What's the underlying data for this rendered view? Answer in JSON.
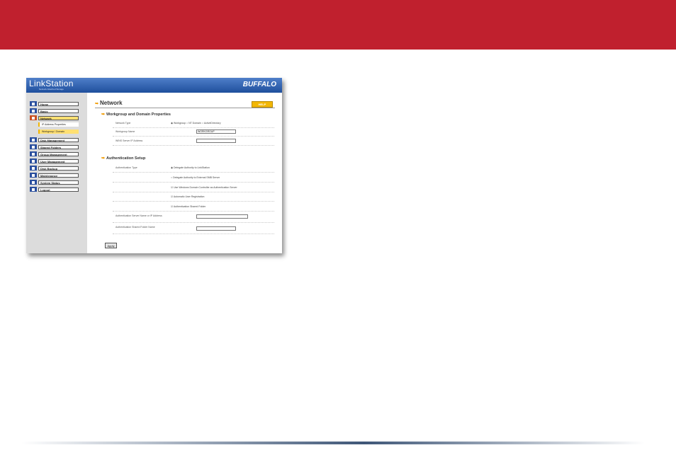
{
  "app": {
    "logo": "LinkStation",
    "logo_sub": "Network Attached Storage",
    "brand": "BUFFALO"
  },
  "sidebar": {
    "items": [
      {
        "label": "Home"
      },
      {
        "label": "Basic"
      },
      {
        "label": "Network"
      },
      {
        "label": "Disk Management"
      },
      {
        "label": "Shared Folders"
      },
      {
        "label": "Group Management"
      },
      {
        "label": "User Management"
      },
      {
        "label": "Disk Backup"
      },
      {
        "label": "Maintenance"
      },
      {
        "label": "System Status"
      },
      {
        "label": "Logout"
      }
    ],
    "subitems": [
      {
        "label": "IP Address Properties"
      },
      {
        "label": "Workgroup / Domain"
      }
    ]
  },
  "page": {
    "title": "Network",
    "help_label": "HELP",
    "section1": {
      "title": "Workgroup and Domain Properties",
      "network_type_label": "Network Type",
      "network_type_options": [
        "Workgroup",
        "NT Domain",
        "ActiveDirectory"
      ],
      "workgroup_name_label": "Workgroup Name",
      "workgroup_name_value": "WORKGROUP",
      "wins_label": "WINS Server IP Address",
      "wins_value": ""
    },
    "section2": {
      "title": "Authentication Setup",
      "auth_type_label": "Authentication Type",
      "auth_option1": "Delegate Authority to LinkStation",
      "auth_option2": "Delegate Authority to External SMB Server",
      "check1": "Use Windows Domain Controller as Authentication Server",
      "check2": "Automatic User Registration",
      "check3": "Authentication Shared Folder",
      "auth_server_label": "Authentication Server Name or IP Address",
      "auth_server_value": "",
      "auth_folder_label": "Authentication Shared Folder Name",
      "auth_folder_value": ""
    },
    "apply_label": "Apply"
  },
  "colors": {
    "topbar": "#c0202e",
    "banner": "#2a5cae",
    "accent": "#f2b705"
  }
}
